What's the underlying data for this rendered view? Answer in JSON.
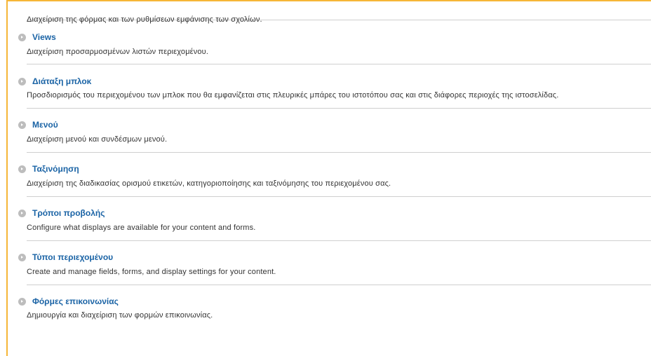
{
  "top_description": "Διαχείριση της φόρμας και των ρυθμίσεων εμφάνισης των σχολίων.",
  "items": [
    {
      "title": "Views",
      "description": "Διαχείριση προσαρμοσμένων λιστών περιεχομένου.",
      "icon": "circle-arrow-icon"
    },
    {
      "title": "Διάταξη μπλοκ",
      "description": "Προσδιορισμός του περιεχομένου των μπλοκ που θα εμφανίζεται στις πλευρικές μπάρες του ιστοτόπου σας και στις διάφορες περιοχές της ιστοσελίδας.",
      "icon": "circle-arrow-icon"
    },
    {
      "title": "Μενού",
      "description": "Διαχείριση μενού και συνδέσμων μενού.",
      "icon": "circle-arrow-icon"
    },
    {
      "title": "Ταξινόμηση",
      "description": "Διαχείριση της διαδικασίας ορισμού ετικετών, κατηγοριοποίησης και ταξινόμησης του περιεχομένου σας.",
      "icon": "circle-arrow-icon"
    },
    {
      "title": "Τρόποι προβολής",
      "description": "Configure what displays are available for your content and forms.",
      "icon": "circle-arrow-icon"
    },
    {
      "title": "Τύποι περιεχομένου",
      "description": "Create and manage fields, forms, and display settings for your content.",
      "icon": "circle-arrow-icon"
    },
    {
      "title": "Φόρμες επικοινωνίας",
      "description": "Δημιουργία και διαχείριση των φορμών επικοινωνίας.",
      "icon": "circle-arrow-icon"
    }
  ],
  "colors": {
    "accent_border": "#f6b637",
    "link": "#1a63a5",
    "text": "#333333",
    "divider": "#cfcfcf",
    "icon": "#bdbdbd"
  }
}
